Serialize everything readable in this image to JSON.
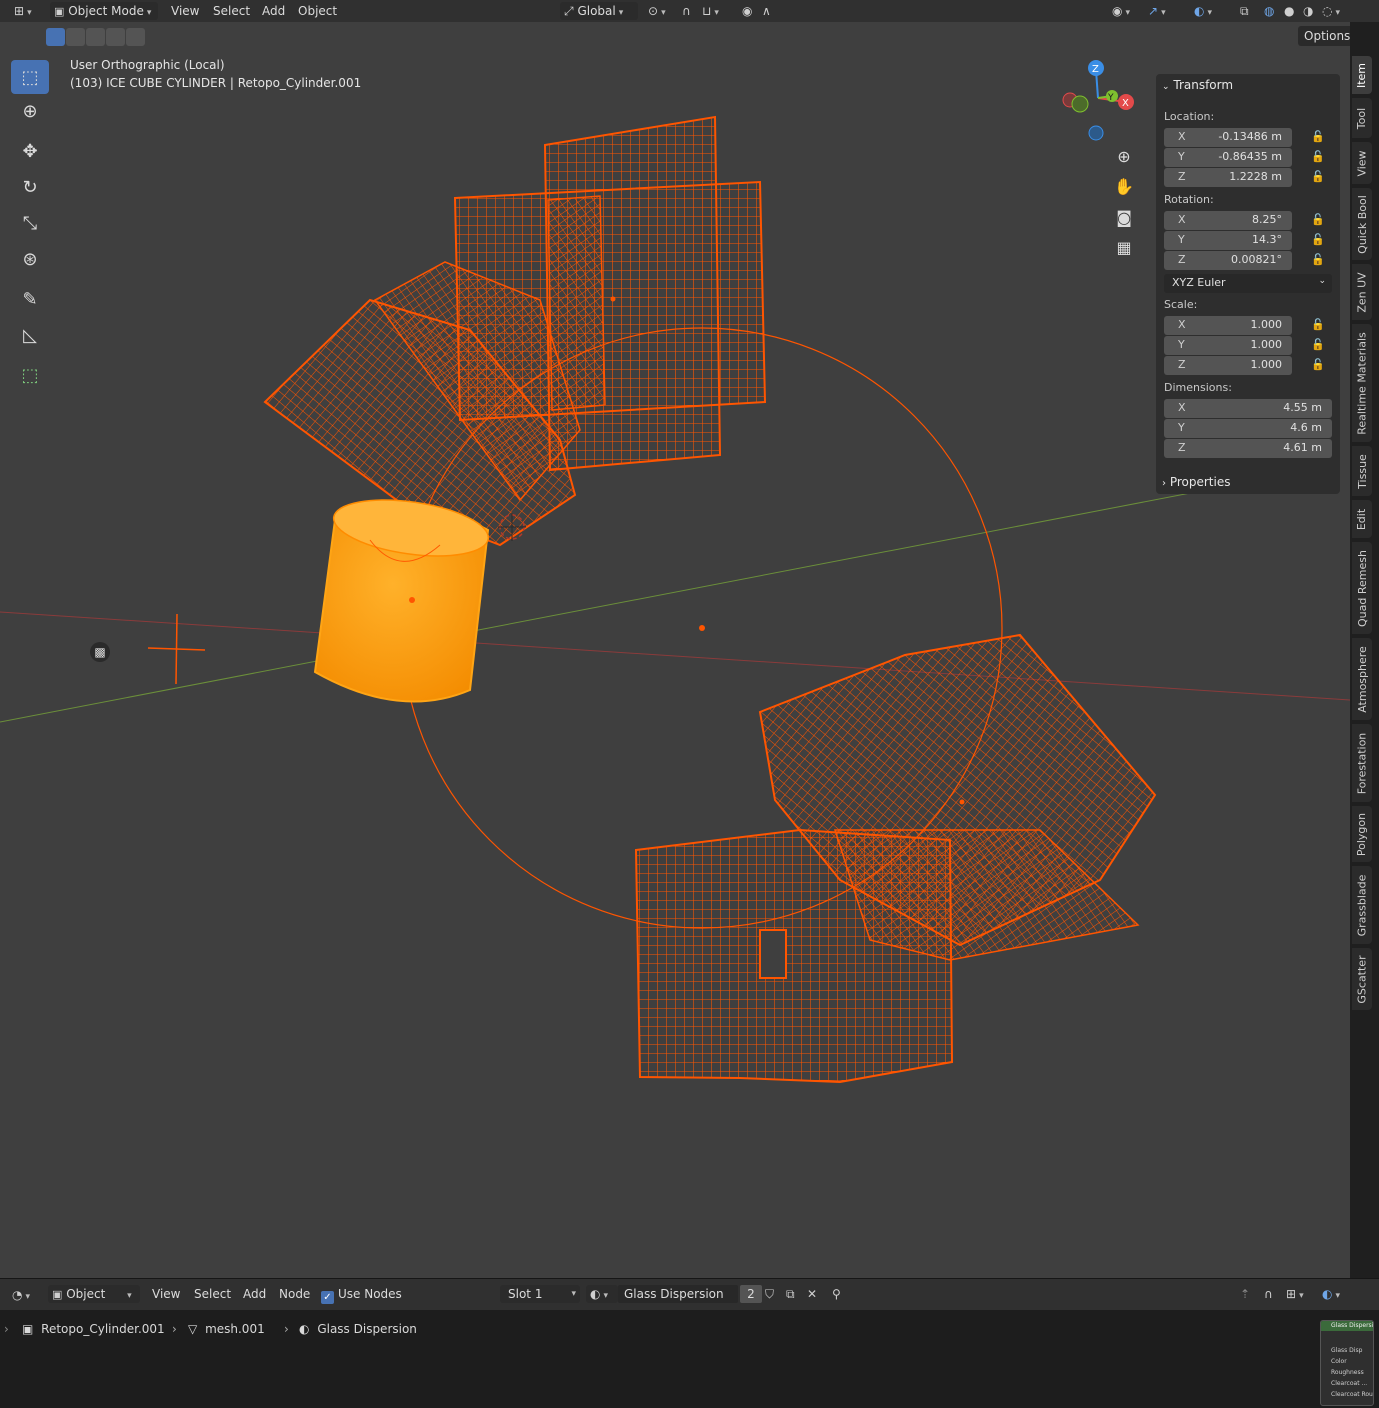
{
  "header": {
    "mode": "Object Mode",
    "menu": [
      "View",
      "Select",
      "Add",
      "Object"
    ],
    "orientation": "Global",
    "options_label": "Options"
  },
  "viewport": {
    "view_name": "User Orthographic (Local)",
    "object_info": "(103) ICE CUBE CYLINDER | Retopo_Cylinder.001",
    "gizmo_axes": [
      "Z",
      "Y",
      "X"
    ]
  },
  "npanel": {
    "transform_title": "Transform",
    "location_label": "Location:",
    "location": [
      {
        "axis": "X",
        "value": "-0.13486 m"
      },
      {
        "axis": "Y",
        "value": "-0.86435 m"
      },
      {
        "axis": "Z",
        "value": "1.2228 m"
      }
    ],
    "rotation_label": "Rotation:",
    "rotation": [
      {
        "axis": "X",
        "value": "8.25°"
      },
      {
        "axis": "Y",
        "value": "14.3°"
      },
      {
        "axis": "Z",
        "value": "0.00821°"
      }
    ],
    "rotation_mode": "XYZ Euler",
    "scale_label": "Scale:",
    "scale": [
      {
        "axis": "X",
        "value": "1.000"
      },
      {
        "axis": "Y",
        "value": "1.000"
      },
      {
        "axis": "Z",
        "value": "1.000"
      }
    ],
    "dimensions_label": "Dimensions:",
    "dimensions": [
      {
        "axis": "X",
        "value": "4.55 m"
      },
      {
        "axis": "Y",
        "value": "4.6 m"
      },
      {
        "axis": "Z",
        "value": "4.61 m"
      }
    ],
    "properties_title": "Properties"
  },
  "side_tabs": [
    "Item",
    "Tool",
    "View",
    "Quick Bool",
    "Zen UV",
    "Realtime Materials",
    "Tissue",
    "Edit",
    "Quad Remesh",
    "Atmosphere",
    "Forestation",
    "Polygon",
    "Grassblade",
    "GScatter"
  ],
  "node_header": {
    "mode": "Object",
    "menu": [
      "View",
      "Select",
      "Add",
      "Node"
    ],
    "use_nodes_label": "Use Nodes",
    "slot": "Slot 1",
    "material": "Glass Dispersion",
    "users": "2"
  },
  "breadcrumb": {
    "object": "Retopo_Cylinder.001",
    "mesh": "mesh.001",
    "material": "Glass Dispersion"
  },
  "mini_node": {
    "title": "Glass Dispersion",
    "rows": [
      "Glass Disp",
      "Color",
      "Roughness",
      "Clearcoat ...",
      "Clearcoat Rou"
    ]
  },
  "colors": {
    "viewport_bg": "#3f3f3f",
    "wire": "#ff5500",
    "selected_solid": "#ffa515",
    "accent": "#4772b3",
    "x_axis": "#e34a4a",
    "y_axis": "#7fbf2f",
    "z_axis": "#3a8ee6"
  }
}
